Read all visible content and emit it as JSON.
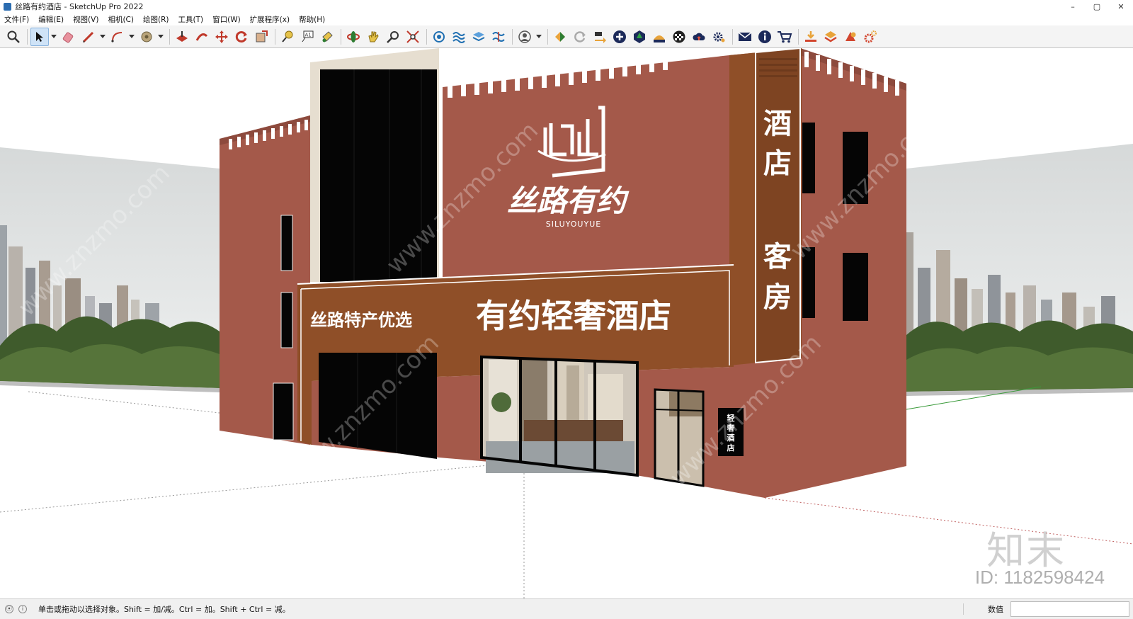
{
  "window": {
    "title": "丝路有约酒店 - SketchUp Pro 2022",
    "controls": [
      "–",
      "▢",
      "✕"
    ]
  },
  "menu": [
    "文件(F)",
    "编辑(E)",
    "视图(V)",
    "相机(C)",
    "绘图(R)",
    "工具(T)",
    "窗口(W)",
    "扩展程序(x)",
    "帮助(H)"
  ],
  "toolbar": {
    "groups": [
      [
        "zoom-icon"
      ],
      [
        "select-icon",
        "eraser-icon",
        "pencil-icon",
        "arc-icon",
        "paint-bucket-icon"
      ],
      [
        "push-pull-icon",
        "follow-me-icon",
        "move-icon",
        "rotate-icon",
        "scale-icon"
      ],
      [
        "tape-measure-icon",
        "text-icon",
        "paint-icon"
      ],
      [
        "orbit-icon",
        "pan-icon",
        "zoom-window-icon",
        "zoom-extents-icon"
      ],
      [
        "components-icon",
        "materials-icon",
        "styles-icon",
        "layers-icon"
      ],
      [
        "user-icon"
      ],
      [
        "warehouse-icon",
        "refresh-icon",
        "export-icon",
        "add-icon",
        "tree-icon",
        "sun-icon",
        "pattern-icon",
        "cloud-icon",
        "settings-icon"
      ],
      [
        "mail-icon",
        "info-icon",
        "cart-icon"
      ],
      [
        "import-icon",
        "export-model-icon",
        "plugin-icon",
        "gear-plugin-icon"
      ]
    ]
  },
  "scene": {
    "logo_text": "丝路有约",
    "logo_sub": "SILUYOUYUE",
    "sign_left": "丝路特产优选",
    "sign_main": "有约轻奢酒店",
    "vertical_sign_top": [
      "酒",
      "店"
    ],
    "vertical_sign_bottom": [
      "客",
      "房"
    ],
    "small_sign": [
      "轻",
      "奢",
      "酒",
      "店"
    ],
    "watermark": "www.znzmo.com",
    "colors": {
      "facade": "#a4594a",
      "facade_dark": "#8d4a3d",
      "sign_band": "#8f4f28",
      "glass": "#050505",
      "ground": "#ffffff",
      "sky": "#e5e7e7"
    }
  },
  "status": {
    "message": "单击或拖动以选择对象。Shift = 加/减。Ctrl = 加。Shift + Ctrl = 减。",
    "measure_label": "数值",
    "measure_value": ""
  },
  "overlay": {
    "brand": "知末",
    "id_text": "ID: 1182598424"
  }
}
